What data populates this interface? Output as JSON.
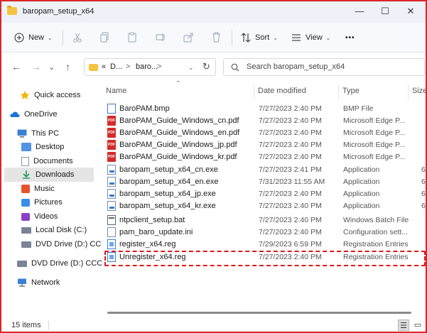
{
  "window": {
    "title": "baropam_setup_x64",
    "controls": {
      "minimize": "—",
      "maximize": "☐",
      "close": "✕"
    }
  },
  "toolbar": {
    "new_label": "New",
    "sort_label": "Sort",
    "view_label": "View",
    "more_label": "•••",
    "icons": [
      "cut-icon",
      "copy-icon",
      "paste-icon",
      "rename-icon",
      "share-icon",
      "delete-icon"
    ]
  },
  "address": {
    "overflow": "«",
    "crumbs": [
      "D...",
      "baro..."
    ],
    "separator": ">"
  },
  "search": {
    "placeholder": "Search baropam_setup_x64"
  },
  "sidebar": {
    "items": [
      {
        "label": "Quick access",
        "icon": "star-icon",
        "color": "#f0b400"
      },
      {
        "label": "OneDrive",
        "icon": "cloud-icon",
        "color": "#1a73d9"
      },
      {
        "label": "This PC",
        "icon": "monitor-icon",
        "color": "#3b7fd6"
      },
      {
        "label": "Desktop",
        "icon": "desktop-icon",
        "color": "#4f93e3"
      },
      {
        "label": "Documents",
        "icon": "documents-icon",
        "color": "#8a96a8"
      },
      {
        "label": "Downloads",
        "icon": "download-icon",
        "color": "#1e9b58",
        "selected": true
      },
      {
        "label": "Music",
        "icon": "music-icon",
        "color": "#e2542c"
      },
      {
        "label": "Pictures",
        "icon": "pictures-icon",
        "color": "#3b8ee6"
      },
      {
        "label": "Videos",
        "icon": "videos-icon",
        "color": "#8b3fc7"
      },
      {
        "label": "Local Disk (C:)",
        "icon": "disk-icon",
        "color": "#7a8494"
      },
      {
        "label": "DVD Drive (D:) CCCC",
        "icon": "dvd-icon",
        "color": "#7a8494"
      },
      {
        "label": "DVD Drive (D:) CCCC",
        "icon": "dvd-icon",
        "color": "#7a8494"
      },
      {
        "label": "Network",
        "icon": "network-icon",
        "color": "#3b7fd6"
      }
    ]
  },
  "columns": {
    "name": "Name",
    "date": "Date modified",
    "type": "Type",
    "size": "Size"
  },
  "files": [
    {
      "name": "BaroPAM.bmp",
      "date": "7/27/2023 2:40 PM",
      "type": "BMP File",
      "size": "",
      "icon": "bmp"
    },
    {
      "name": "BaroPAM_Guide_Windows_cn.pdf",
      "date": "7/27/2023 2:40 PM",
      "type": "Microsoft Edge P...",
      "size": "",
      "icon": "pdf"
    },
    {
      "name": "BaroPAM_Guide_Windows_en.pdf",
      "date": "7/27/2023 2:40 PM",
      "type": "Microsoft Edge P...",
      "size": "",
      "icon": "pdf"
    },
    {
      "name": "BaroPAM_Guide_Windows_jp.pdf",
      "date": "7/27/2023 2:40 PM",
      "type": "Microsoft Edge P...",
      "size": "",
      "icon": "pdf"
    },
    {
      "name": "BaroPAM_Guide_Windows_kr.pdf",
      "date": "7/27/2023 2:40 PM",
      "type": "Microsoft Edge P...",
      "size": "",
      "icon": "pdf"
    },
    {
      "name": "baropam_setup_x64_cn.exe",
      "date": "7/27/2023 2:41 PM",
      "type": "Application",
      "size": "6",
      "icon": "exe"
    },
    {
      "name": "baropam_setup_x64_en.exe",
      "date": "7/31/2023 11:55 AM",
      "type": "Application",
      "size": "6",
      "icon": "exe"
    },
    {
      "name": "baropam_setup_x64_jp.exe",
      "date": "7/27/2023 2:40 PM",
      "type": "Application",
      "size": "6",
      "icon": "exe"
    },
    {
      "name": "baropam_setup_x64_kr.exe",
      "date": "7/27/2023 2:40 PM",
      "type": "Application",
      "size": "6",
      "icon": "exe"
    },
    {
      "name": "ntpclient_setup.bat",
      "date": "7/27/2023 2:40 PM",
      "type": "Windows Batch File",
      "size": "",
      "icon": "bat"
    },
    {
      "name": "pam_baro_update.ini",
      "date": "7/27/2023 2:40 PM",
      "type": "Configuration sett...",
      "size": "",
      "icon": "doc"
    },
    {
      "name": "register_x64.reg",
      "date": "7/29/2023 6:59 PM",
      "type": "Registration Entries",
      "size": "",
      "icon": "reg"
    },
    {
      "name": "Unregister_x64.reg",
      "date": "7/27/2023 2:40 PM",
      "type": "Registration Entries",
      "size": "",
      "icon": "reg"
    }
  ],
  "status": {
    "count": "15 items"
  },
  "colors": {
    "frame": "#d9262b",
    "highlight": "#e0161c",
    "folder": "#f4c341"
  }
}
